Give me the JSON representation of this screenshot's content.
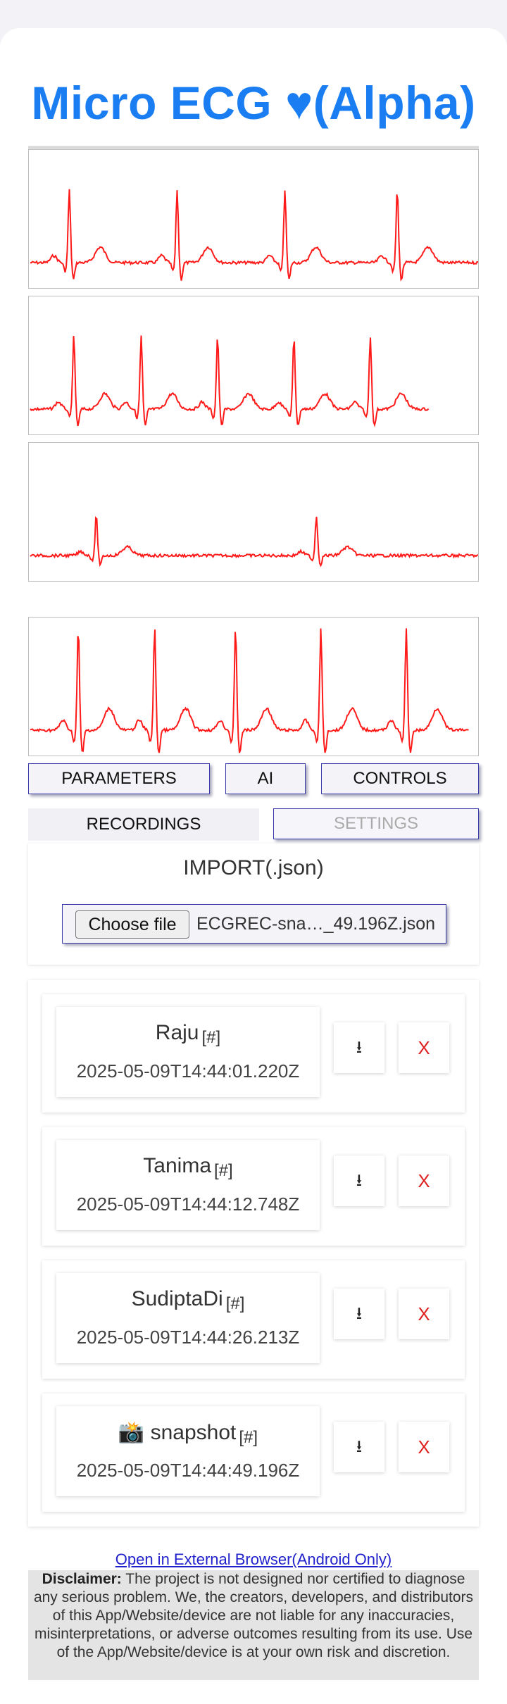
{
  "app": {
    "title": "Micro ECG ♥(Alpha)",
    "title_color": "#1a7ef2"
  },
  "ecg": {
    "trace_color": "#ff1a1a",
    "panels": [
      {
        "beats": [
          0.09,
          0.33,
          0.57,
          0.82
        ],
        "end": 1.0,
        "amp": 1.0
      },
      {
        "beats": [
          0.1,
          0.25,
          0.42,
          0.59,
          0.76
        ],
        "end": 0.89,
        "amp": 1.0
      },
      {
        "beats": [
          0.15,
          0.64
        ],
        "end": 1.0,
        "amp": 0.55
      },
      {
        "beats": [
          0.11,
          0.28,
          0.46,
          0.65,
          0.84
        ],
        "end": 0.98,
        "amp": 1.4
      }
    ]
  },
  "tabs": {
    "parameters": "PARAMETERS",
    "ai": "AI",
    "controls": "CONTROLS",
    "recordings": "RECORDINGS",
    "settings": "SETTINGS"
  },
  "import": {
    "title": "IMPORT(.json)",
    "choose_label": "Choose file",
    "file_name": "ECGREC-sna…_49.196Z.json"
  },
  "records": [
    {
      "name": "Raju",
      "tag": "[#]",
      "timestamp": "2025-05-09T14:44:01.220Z",
      "download": "⭳",
      "delete": "X"
    },
    {
      "name": "Tanima",
      "tag": "[#]",
      "timestamp": "2025-05-09T14:44:12.748Z",
      "download": "⭳",
      "delete": "X"
    },
    {
      "name": "SudiptaDi",
      "tag": "[#]",
      "timestamp": "2025-05-09T14:44:26.213Z",
      "download": "⭳",
      "delete": "X"
    },
    {
      "name": "📸 snapshot",
      "tag": "[#]",
      "timestamp": "2025-05-09T14:44:49.196Z",
      "download": "⭳",
      "delete": "X"
    }
  ],
  "footer": {
    "link_text": "Open in External Browser(Android Only)",
    "disclaimer_label": "Disclaimer:",
    "disclaimer_text": " The project is not designed nor certified to diagnose any serious problem. We, the creators, developers, and distributors of this App/Website/device are not liable for any inaccuracies, misinterpretations, or adverse outcomes resulting from its use. Use of the App/Website/device is at your own risk and discretion."
  }
}
